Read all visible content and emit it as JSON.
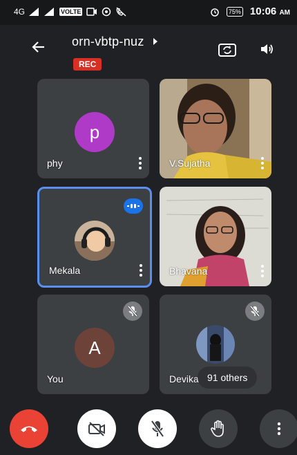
{
  "status_bar": {
    "network": "4G",
    "volte": "VOLTE",
    "battery": "75%",
    "time": "10:06",
    "ampm": "AM"
  },
  "header": {
    "meeting_code": "orn-vbtp-nuz",
    "recording_badge": "REC"
  },
  "participants": [
    {
      "name": "phy",
      "avatar_letter": "p",
      "avatar_color": "#b03ac8"
    },
    {
      "name": "V.Sujatha"
    },
    {
      "name": "Mekala",
      "active_speaker": true
    },
    {
      "name": "Bhavana"
    },
    {
      "name": "You",
      "avatar_letter": "A",
      "avatar_color": "#6d4239",
      "muted": true
    },
    {
      "name": "Devika",
      "muted": true
    }
  ],
  "others_chip": "91 others",
  "colors": {
    "end_call": "#ea4335",
    "active_border": "#5a8ff0",
    "tile_bg": "#3c4043"
  },
  "controls": [
    "end-call",
    "camera-off",
    "mic-off",
    "raise-hand",
    "more-options"
  ]
}
